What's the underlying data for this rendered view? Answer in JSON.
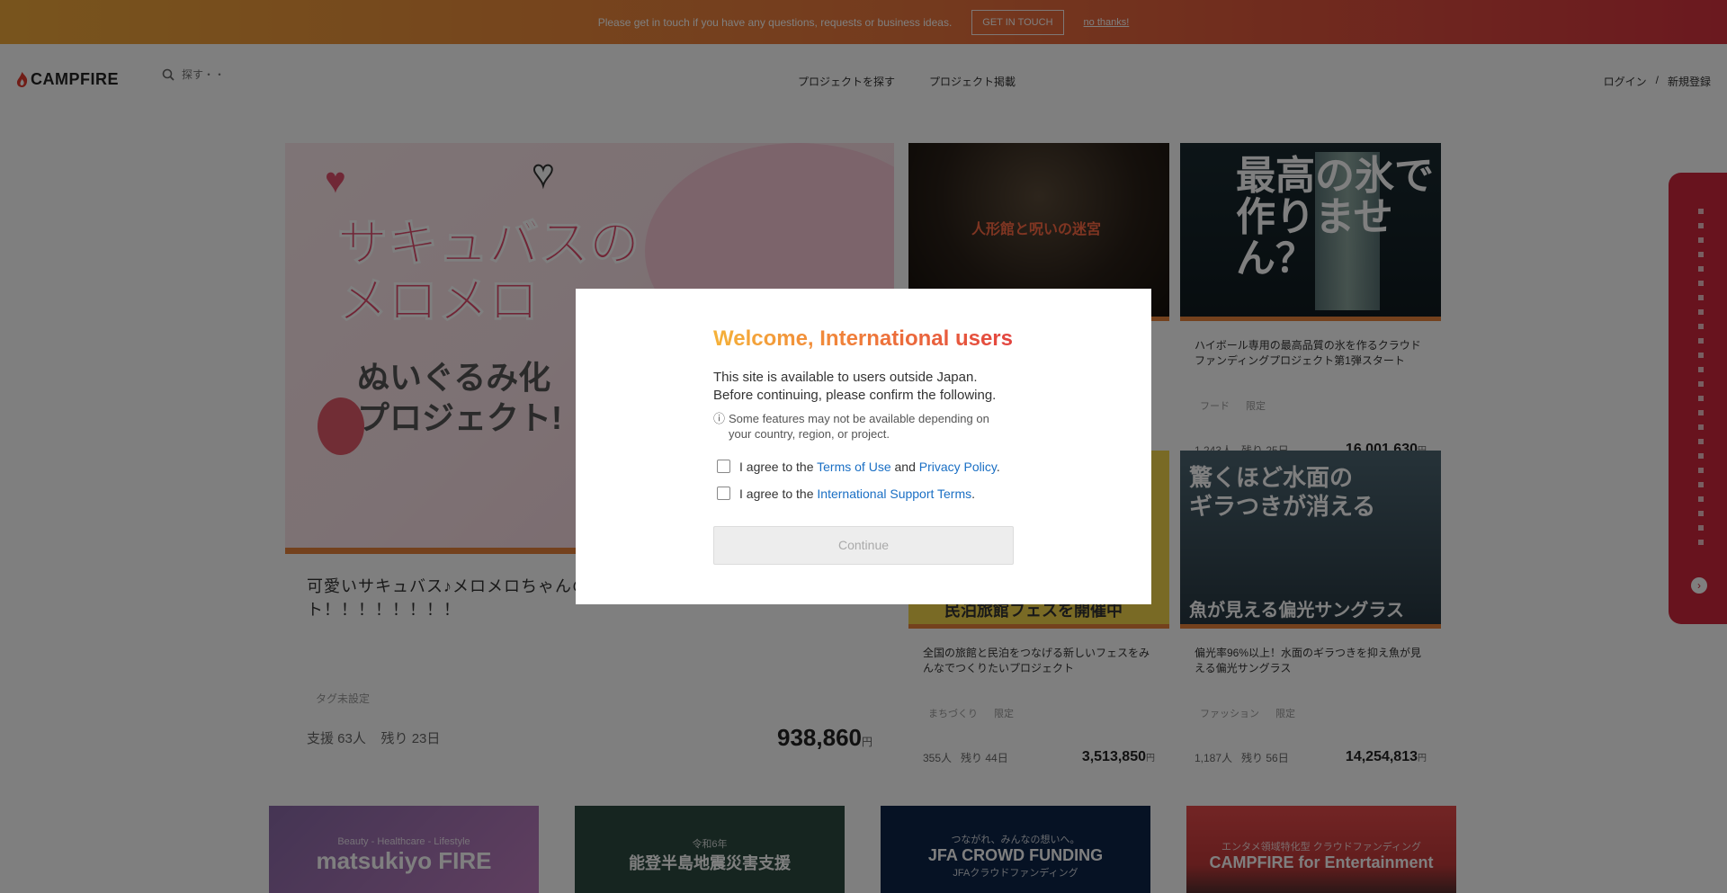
{
  "banner": {
    "message": "Please get in touch if you have any questions, requests or business ideas.",
    "cta_label": "GET IN TOUCH",
    "dismiss_label": "no thanks!"
  },
  "header": {
    "logo_text": "CAMPFIRE",
    "search_placeholder": "探す・・",
    "nav_items": [
      "プロジェクトを探す",
      "プロジェクト掲載"
    ],
    "account_login": "ログイン",
    "account_separator": "/",
    "account_signup": "新規登録"
  },
  "featured": {
    "thumb_title_line1": "サキュバスの",
    "thumb_title_line2": "メロメロ",
    "thumb_title_line3": "ぬいぐるみ化",
    "thumb_title_line4": "プロジェクト!",
    "title": "可愛いサキュバス♪メロメロちゃんのぬいぐるみ化プロジェクト！！！！！！！！",
    "tag": "タグ未設定",
    "supporters": "支援 63人",
    "days_left": "残り 23日",
    "amount": "938,860",
    "currency": "円"
  },
  "cards": [
    {
      "thumb_text": "人形館と呪いの迷宮",
      "title": "",
      "tag1": "",
      "tag2": "",
      "supporters": "",
      "days_left": "",
      "amount": "",
      "currency": ""
    },
    {
      "thumb_text": "最高の氷で作りません？",
      "title": "ハイボール専用の最高品質の氷を作るクラウドファンディングプロジェクト第1弾スタート",
      "tag1": "フード",
      "tag2": "限定",
      "supporters": "1,243人",
      "days_left": "残り 25日",
      "amount": "16,001,630",
      "currency": "円"
    },
    {
      "thumb_text": "民泊旅館フェスを開催中",
      "title": "全国の旅館と民泊をつなげる新しいフェスをみんなでつくりたいプロジェクト",
      "tag1": "まちづくり",
      "tag2": "限定",
      "supporters": "355人",
      "days_left": "残り 44日",
      "amount": "3,513,850",
      "currency": "円"
    },
    {
      "thumb_text1": "驚くほど水面の",
      "thumb_text2": "ギラつきが消える",
      "thumb_text3": "魚が見える偏光サングラス",
      "title": "偏光率96%以上！水面のギラつきを抑え魚が見える偏光サングラス",
      "tag1": "ファッション",
      "tag2": "限定",
      "supporters": "1,187人",
      "days_left": "残り 56日",
      "amount": "14,254,813",
      "currency": "円"
    }
  ],
  "bottom_banners": [
    {
      "small": "Beauty - Healthcare - Lifestyle",
      "big": "matsukiyo FIRE"
    },
    {
      "small": "令和6年",
      "big": "能登半島地震災害支援"
    },
    {
      "small": "つながれ、みんなの想いへ。",
      "big": "JFA CROWD FUNDING",
      "sub": "JFAクラウドファンディング"
    },
    {
      "small": "エンタメ領域特化型 クラウドファンディング",
      "big": "CAMPFIRE for Entertainment"
    }
  ],
  "modal": {
    "title": "Welcome, International users",
    "description": "This site is available to users outside Japan. Before continuing, please confirm the following.",
    "note_icon": "info-icon",
    "note": "Some features may not be available depending on your country, region, or project.",
    "check1_prefix": "I agree to the ",
    "check1_link1": "Terms of Use",
    "check1_mid": " and ",
    "check1_link2": "Privacy Policy",
    "check1_suffix": ".",
    "check2_prefix": "I agree to the ",
    "check2_link": "International Support Terms",
    "check2_suffix": ".",
    "continue_label": "Continue"
  },
  "colors": {
    "brand_red": "#d0273c",
    "link_blue": "#1a6fc4",
    "modal_gradient_start": "#f5b23a",
    "modal_gradient_end": "#e2433f"
  }
}
